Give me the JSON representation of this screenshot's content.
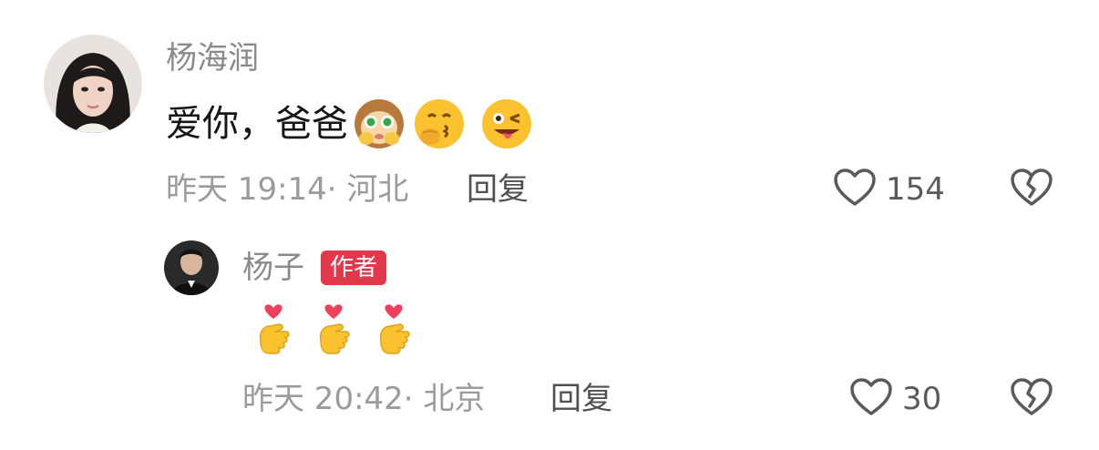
{
  "comments": [
    {
      "author": "杨海润",
      "text": "爱你，爸爸",
      "emojis": [
        "shy-monkey-emoji",
        "kiss-emoji",
        "tongue-wink-emoji"
      ],
      "time": "昨天 19:14",
      "location": "· 河北",
      "reply_label": "回复",
      "like_count": "154",
      "icons": {
        "like": "heart-outline-icon",
        "dislike": "broken-heart-icon"
      }
    },
    {
      "author": "杨子",
      "badge": "作者",
      "emojis": [
        "finger-heart-emoji",
        "finger-heart-emoji",
        "finger-heart-emoji"
      ],
      "time": "昨天 20:42",
      "location": "· 北京",
      "reply_label": "回复",
      "like_count": "30",
      "icons": {
        "like": "heart-outline-icon",
        "dislike": "broken-heart-icon"
      }
    }
  ],
  "colors": {
    "badge": "#e2384b",
    "name": "#8a8a8a",
    "meta": "#9b9b9b",
    "icon": "#5a5a5a"
  }
}
